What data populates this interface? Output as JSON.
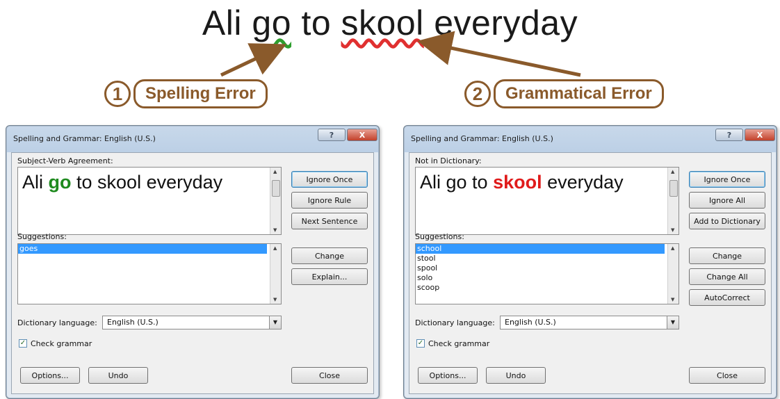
{
  "headline": {
    "w1": "Ali",
    "w2": "go",
    "w3": "to",
    "w4": "skool",
    "w5": "everyday"
  },
  "callouts": [
    {
      "number": "1",
      "label": "Spelling Error"
    },
    {
      "number": "2",
      "label": "Grammatical Error"
    }
  ],
  "dialog_left": {
    "title": "Spelling and Grammar: English (U.S.)",
    "help_label": "?",
    "close_x": "X",
    "error_type_label": "Subject-Verb Agreement:",
    "sentence": {
      "before": "Ali ",
      "flagged": "go",
      "after": " to skool everyday"
    },
    "suggestions_label": "Suggestions:",
    "suggestions": [
      "goes"
    ],
    "buttons": {
      "ignore_once": "Ignore Once",
      "ignore_rule": "Ignore Rule",
      "next_sentence": "Next Sentence",
      "change": "Change",
      "explain": "Explain...",
      "options": "Options...",
      "undo": "Undo",
      "close": "Close"
    },
    "dictionary_language_label": "Dictionary language:",
    "dictionary_language_value": "English (U.S.)",
    "check_grammar_label": "Check grammar"
  },
  "dialog_right": {
    "title": "Spelling and Grammar: English (U.S.)",
    "help_label": "?",
    "close_x": "X",
    "error_type_label": "Not in Dictionary:",
    "sentence": {
      "before": "Ali go to ",
      "flagged": "skool",
      "after": " everyday"
    },
    "suggestions_label": "Suggestions:",
    "suggestions": [
      "school",
      "stool",
      "spool",
      "solo",
      "scoop"
    ],
    "buttons": {
      "ignore_once": "Ignore Once",
      "ignore_all": "Ignore All",
      "add_to_dictionary": "Add to Dictionary",
      "change": "Change",
      "change_all": "Change All",
      "autocorrect": "AutoCorrect",
      "options": "Options...",
      "undo": "Undo",
      "close": "Close"
    },
    "dictionary_language_label": "Dictionary language:",
    "dictionary_language_value": "English (U.S.)",
    "check_grammar_label": "Check grammar"
  }
}
